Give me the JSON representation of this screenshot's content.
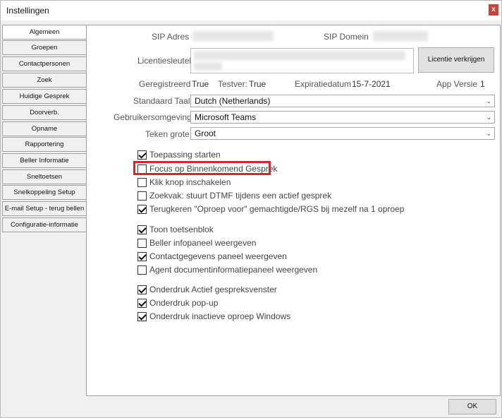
{
  "window": {
    "title": "Instellingen",
    "close_label": "x"
  },
  "tabs": [
    "Algemeen",
    "Groepen",
    "Contactpersonen",
    "Zoek",
    "Huidige Gesprek",
    "Doorverb.",
    "Opname",
    "Rapportering",
    "Beller Informatie",
    "Sneltoetsen",
    "Snelkoppeling Setup",
    "E-mail Setup - terug bellen",
    "Configuratie-informatie"
  ],
  "active_tab": "Algemeen",
  "general": {
    "sip_adres_label": "SIP Adres",
    "sip_domein_label": "SIP Domein",
    "licentiesleutel_label": "Licentiesleutel",
    "licentie_button": "Licentie verkrijgen",
    "geregistreerd_label": "Geregistreerd",
    "geregistreerd_value": "True",
    "testversie_label": "Testver:",
    "testversie_value": "True",
    "expiratiedatum_label": "Expiratiedatum",
    "expiratiedatum_value": "15-7-2021",
    "app_versie_label": "App Versie",
    "app_versie_value": "1",
    "standaard_taal_label": "Standaard Taal",
    "standaard_taal_value": "Dutch (Netherlands)",
    "gebruikersomgeving_label": "Gebruikersomgeving",
    "gebruikersomgeving_value": "Microsoft Teams",
    "teken_grote_label": "Teken grote",
    "teken_grote_value": "Groot"
  },
  "checkboxes": [
    {
      "label": "Toepassing starten",
      "checked": true
    },
    {
      "label": "Focus op Binnenkomend Gesprek",
      "checked": false
    },
    {
      "label": "Klik knop inschakelen",
      "checked": false
    },
    {
      "label": "Zoekvak: stuurt DTMF tijdens een actief gesprek",
      "checked": false
    },
    {
      "label": "Terugkeren \"Oproep voor\" gemachtigde/RGS bij mezelf na 1 oproep",
      "checked": true
    },
    {
      "label": "Toon toetsenblok",
      "checked": true
    },
    {
      "label": "Beller infopaneel weergeven",
      "checked": false
    },
    {
      "label": "Contactgegevens paneel weergeven",
      "checked": true
    },
    {
      "label": "Agent documentinformatiepaneel weergeven",
      "checked": false
    },
    {
      "label": "Onderdruk Actief gespreksvenster",
      "checked": true
    },
    {
      "label": "Onderdruk pop-up",
      "checked": true
    },
    {
      "label": "Onderdruk inactieve oproep Windows",
      "checked": true
    }
  ],
  "footer": {
    "ok_label": "OK"
  },
  "colors": {
    "highlight": "#d9232d"
  }
}
